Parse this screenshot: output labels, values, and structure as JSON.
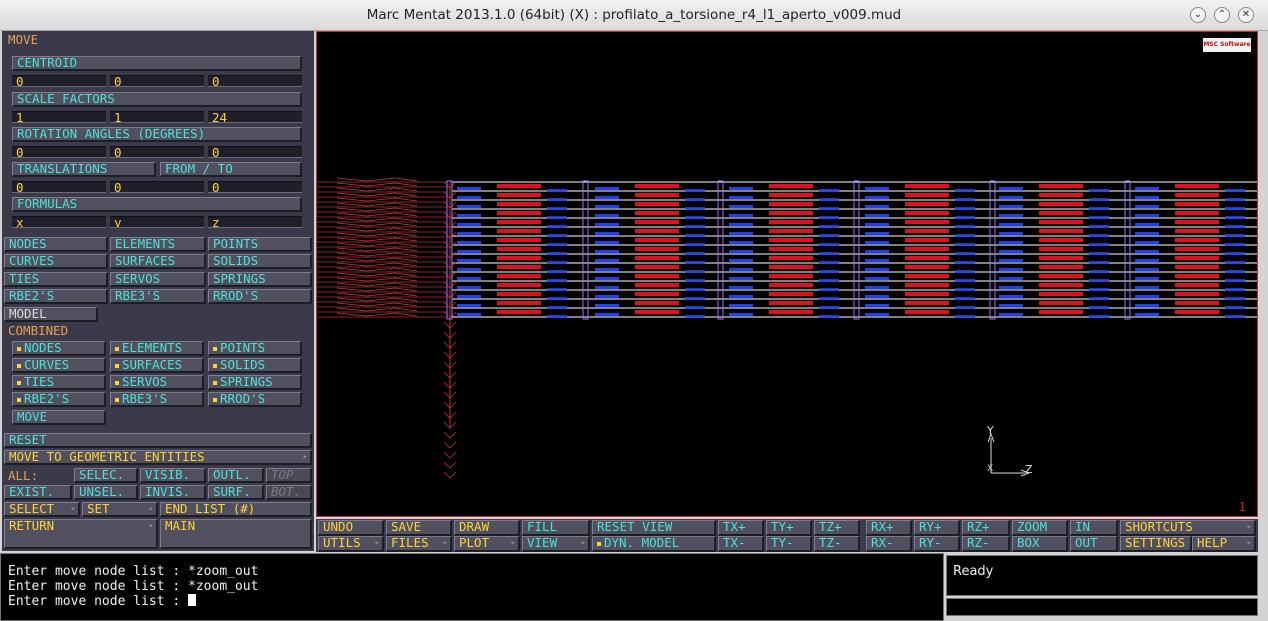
{
  "window": {
    "title": "Marc Mentat 2013.1.0 (64bit) (X) : profilato_a_torsione_r4_l1_aperto_v009.mud"
  },
  "panel": {
    "header": "MOVE",
    "centroid": {
      "label": "CENTROID",
      "values": [
        "0",
        "0",
        "0"
      ]
    },
    "scale": {
      "label": "SCALE FACTORS",
      "values": [
        "1",
        "1",
        "24"
      ]
    },
    "rotation": {
      "label": "ROTATION ANGLES (DEGREES)",
      "values": [
        "0",
        "0",
        "0"
      ]
    },
    "translations": {
      "label": "TRANSLATIONS",
      "from_to": "FROM / TO",
      "values": [
        "0",
        "0",
        "0"
      ]
    },
    "formulas": {
      "label": "FORMULAS",
      "values": [
        "x",
        "y",
        "z"
      ]
    },
    "entities": [
      "NODES",
      "ELEMENTS",
      "POINTS",
      "CURVES",
      "SURFACES",
      "SOLIDS",
      "TIES",
      "SERVOS",
      "SPRINGS",
      "RBE2'S",
      "RBE3'S",
      "RROD'S"
    ],
    "model": "MODEL",
    "combined": "COMBINED",
    "combined_items": [
      "NODES",
      "ELEMENTS",
      "POINTS",
      "CURVES",
      "SURFACES",
      "SOLIDS",
      "TIES",
      "SERVOS",
      "SPRINGS",
      "RBE2'S",
      "RBE3'S",
      "RROD'S"
    ],
    "move": "MOVE",
    "reset": "RESET",
    "move_geo": "MOVE TO GEOMETRIC ENTITIES",
    "all": "ALL:",
    "selec": "SELEC.",
    "visib": "VISIB.",
    "outl": "OUTL.",
    "top": "TOP",
    "exist": "EXIST.",
    "unsel": "UNSEL.",
    "invis": "INVIS.",
    "surf": "SURF.",
    "bot": "BOT.",
    "select": "SELECT",
    "set": "SET",
    "end_list": "END LIST (#)",
    "return": "RETURN",
    "main": "MAIN"
  },
  "viewport": {
    "logo": "MSC Software",
    "number": "1",
    "axes": {
      "y": "Y",
      "z": "Z",
      "x": "X"
    }
  },
  "toolbar": {
    "undo": "UNDO",
    "utils": "UTILS",
    "save": "SAVE",
    "files": "FILES",
    "draw": "DRAW",
    "plot": "PLOT",
    "fill": "FILL",
    "view": "VIEW",
    "reset_view": "RESET VIEW",
    "dyn_model": "DYN. MODEL",
    "txp": "TX+",
    "txm": "TX-",
    "typ": "TY+",
    "tym": "TY-",
    "tzp": "TZ+",
    "tzm": "TZ-",
    "rxp": "RX+",
    "rxm": "RX-",
    "ryp": "RY+",
    "rym": "RY-",
    "rzp": "RZ+",
    "rzm": "RZ-",
    "zoom": "ZOOM",
    "box": "BOX",
    "in": "IN",
    "out": "OUT",
    "shortcuts": "SHORTCUTS",
    "settings": "SETTINGS",
    "help": "HELP"
  },
  "console": {
    "lines": [
      "Enter move node list : *zoom_out",
      "Enter move node list : *zoom_out"
    ],
    "prompt": "Enter move node list : "
  },
  "status": {
    "text": "Ready"
  },
  "colors": {
    "accent": "#4fe0d8",
    "yellow": "#ffd23c",
    "red": "#e01020",
    "blue": "#2040f0"
  }
}
